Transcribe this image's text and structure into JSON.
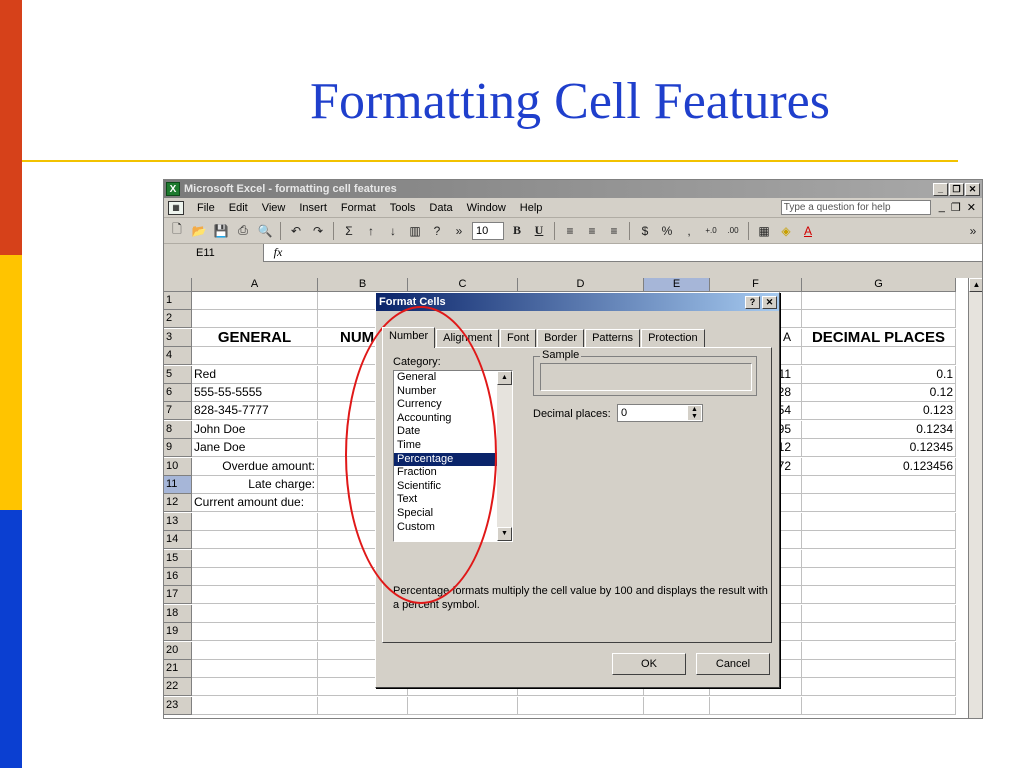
{
  "slide": {
    "title": "Formatting Cell Features",
    "accent_colors": {
      "orange": "#d6411a",
      "yellow": "#ffc400",
      "blue": "#0b3fd1",
      "title": "#1f3fcc",
      "rule": "#f2c200",
      "annotation": "#e01818"
    }
  },
  "window": {
    "title": "Microsoft Excel - formatting cell features",
    "controls": [
      "_",
      "❒",
      "✕"
    ]
  },
  "menubar": {
    "items": [
      "File",
      "Edit",
      "View",
      "Insert",
      "Format",
      "Tools",
      "Data",
      "Window",
      "Help"
    ],
    "help_placeholder": "Type a question for help"
  },
  "toolbar": {
    "font_size": "10",
    "bold": "B",
    "underline": "U",
    "currency": "$",
    "percent": "%",
    "comma": ","
  },
  "formula_bar": {
    "name_box": "E11",
    "fx": "fx"
  },
  "sheet": {
    "columns": [
      "A",
      "B",
      "C",
      "D",
      "E",
      "F",
      "G"
    ],
    "selected_column": "E",
    "selected_row": "11",
    "rows": [
      {
        "n": "1",
        "a": "",
        "b": "",
        "f": "",
        "g": ""
      },
      {
        "n": "2",
        "a": "",
        "b": "",
        "f": "",
        "g": ""
      },
      {
        "n": "3",
        "a": "GENERAL",
        "b": "NUMB",
        "f": "A",
        "g": "DECIMAL PLACES"
      },
      {
        "n": "4",
        "a": "",
        "b": "",
        "f": "",
        "g": ""
      },
      {
        "n": "5",
        "a": "Red",
        "b": "",
        "f": "11",
        "g": "0.1"
      },
      {
        "n": "6",
        "a": "555-55-5555",
        "b": "",
        "f": "28",
        "g": "0.12"
      },
      {
        "n": "7",
        "a": "828-345-7777",
        "b": "",
        "f": "54",
        "g": "0.123"
      },
      {
        "n": "8",
        "a": "John Doe",
        "b": "",
        "f": "95",
        "g": "0.1234"
      },
      {
        "n": "9",
        "a": "Jane Doe",
        "b": "",
        "f": "12",
        "g": "0.12345"
      },
      {
        "n": "10",
        "a": "Overdue amount:",
        "b": "",
        "f": "72",
        "g": "0.123456"
      },
      {
        "n": "11",
        "a": "Late charge:",
        "b": "",
        "f": "",
        "g": ""
      },
      {
        "n": "12",
        "a": "Current amount due:",
        "b": "",
        "f": "",
        "g": ""
      },
      {
        "n": "13",
        "a": "",
        "b": "",
        "f": "",
        "g": ""
      },
      {
        "n": "14",
        "a": "",
        "b": "",
        "f": "",
        "g": ""
      },
      {
        "n": "15",
        "a": "",
        "b": "",
        "f": "",
        "g": ""
      },
      {
        "n": "16",
        "a": "",
        "b": "",
        "f": "",
        "g": ""
      },
      {
        "n": "17",
        "a": "",
        "b": "",
        "f": "",
        "g": ""
      },
      {
        "n": "18",
        "a": "",
        "b": "",
        "f": "",
        "g": ""
      },
      {
        "n": "19",
        "a": "",
        "b": "",
        "f": "",
        "g": ""
      },
      {
        "n": "20",
        "a": "",
        "b": "",
        "f": "",
        "g": ""
      },
      {
        "n": "21",
        "a": "",
        "b": "",
        "f": "",
        "g": ""
      },
      {
        "n": "22",
        "a": "",
        "b": "",
        "f": "",
        "g": ""
      },
      {
        "n": "23",
        "a": "",
        "b": "",
        "f": "",
        "g": ""
      }
    ]
  },
  "dialog": {
    "title": "Format Cells",
    "help_btn": "?",
    "close_btn": "✕",
    "tabs": [
      "Number",
      "Alignment",
      "Font",
      "Border",
      "Patterns",
      "Protection"
    ],
    "active_tab": "Number",
    "category_label": "Category:",
    "categories": [
      "General",
      "Number",
      "Currency",
      "Accounting",
      "Date",
      "Time",
      "Percentage",
      "Fraction",
      "Scientific",
      "Text",
      "Special",
      "Custom"
    ],
    "selected_category": "Percentage",
    "sample_label": "Sample",
    "decimal_label": "Decimal places:",
    "decimal_value": "0",
    "description": "Percentage formats multiply the cell value by 100 and displays the result with a percent symbol.",
    "ok": "OK",
    "cancel": "Cancel"
  }
}
